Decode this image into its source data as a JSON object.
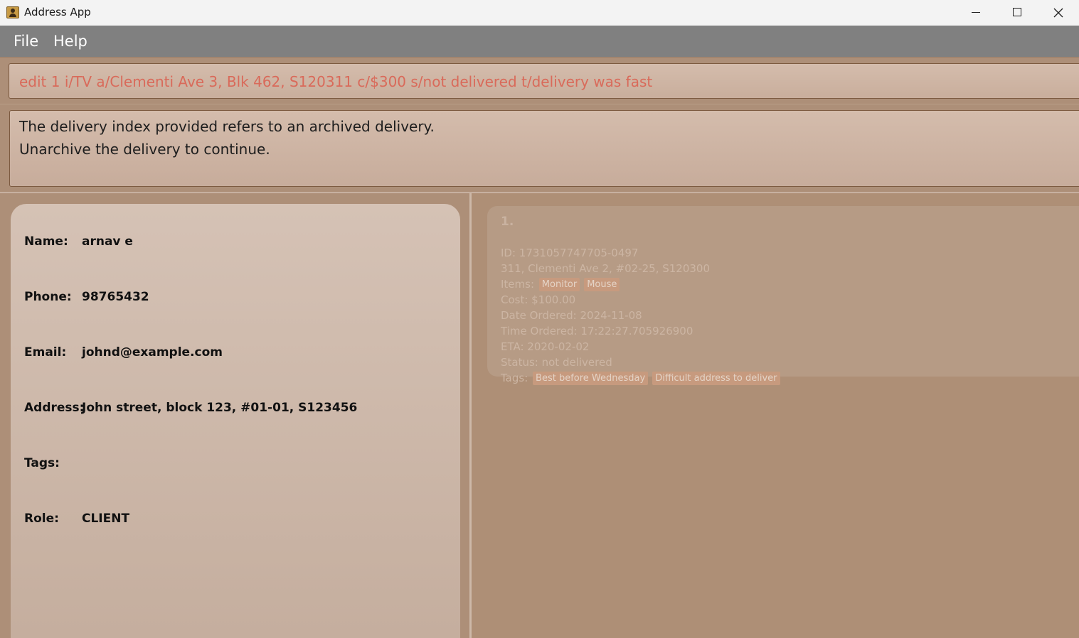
{
  "window": {
    "title": "Address App"
  },
  "menu": {
    "items": [
      "File",
      "Help"
    ]
  },
  "command_box": {
    "value": "edit 1 i/TV a/Clementi Ave 3, Blk 462, S120311 c/$300 s/not delivered t/delivery was fast"
  },
  "result_box": {
    "lines": [
      "The delivery index provided refers to an archived delivery.",
      "Unarchive the delivery to continue."
    ]
  },
  "person": {
    "fields": [
      {
        "label": "Name:",
        "value": "arnav e"
      },
      {
        "label": "Phone:",
        "value": "98765432"
      },
      {
        "label": "Email:",
        "value": "johnd@example.com"
      },
      {
        "label": "Address:",
        "value": "John street, block 123, #01-01, S123456"
      },
      {
        "label": "Tags:",
        "value": ""
      },
      {
        "label": "Role:",
        "value": "CLIENT"
      }
    ]
  },
  "delivery": {
    "index": "1.",
    "id": "ID: 1731057747705-0497",
    "address": "311, Clementi Ave 2, #02-25, S120300",
    "items_label": "Items:",
    "items": [
      "Monitor",
      "Mouse"
    ],
    "cost": "Cost: $100.00",
    "date_ordered": "Date Ordered: 2024-11-08",
    "time_ordered": "Time Ordered: 17:22:27.705926900",
    "eta": "ETA: 2020-02-02",
    "status": "Status: not delivered",
    "tags_label": "Tags:",
    "tags": [
      "Best before Wednesday",
      "Difficult address to deliver"
    ]
  },
  "colors": {
    "command_text": "#d96a5a",
    "menubar": "#808080",
    "background": "#ad8f78"
  },
  "icons": [
    "address-app-icon",
    "minimize-icon",
    "maximize-icon",
    "close-icon"
  ]
}
